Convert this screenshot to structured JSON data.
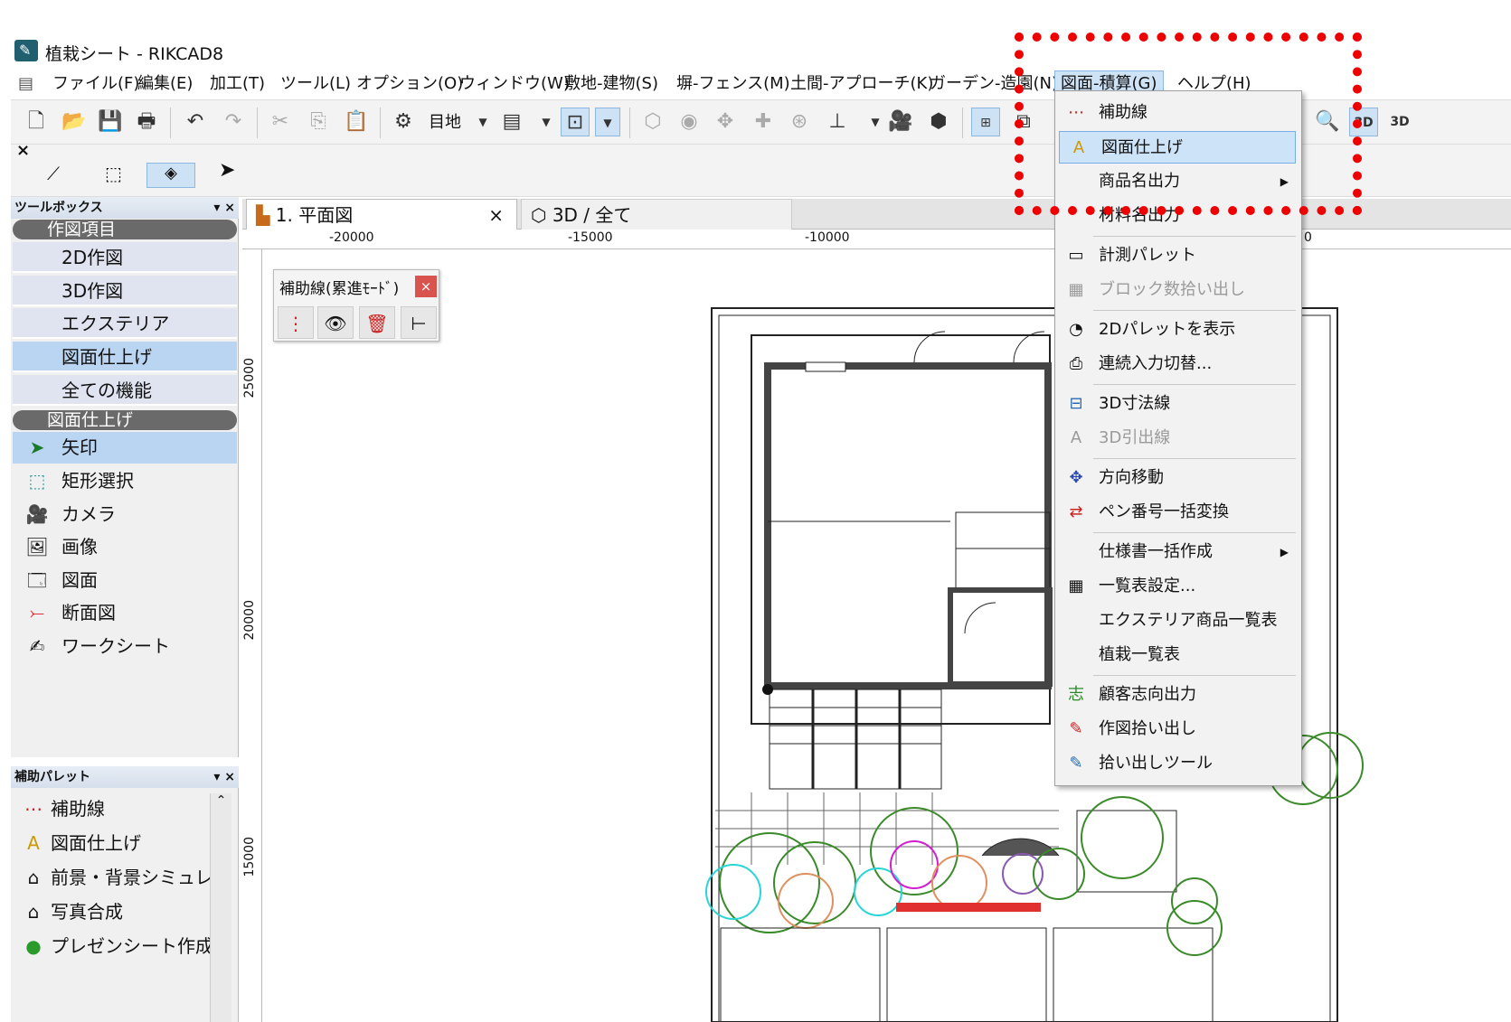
{
  "window": {
    "title": "植栽シート - RIKCAD8"
  },
  "menu": {
    "items": [
      "ファイル(F)",
      "編集(E)",
      "加工(T)",
      "ツール(L)",
      "オプション(O)",
      "ウィンドウ(W)",
      "敷地-建物(S)",
      "塀-フェンス(M)",
      "土間-アプローチ(K)",
      "ガーデン-造園(N)",
      "図面-積算(G)",
      "ヘルプ(H)"
    ],
    "active": "図面-積算(G)"
  },
  "toolbar": {
    "layer_label": "目地"
  },
  "toolbox": {
    "title": "ツールボックス",
    "group1": "作図項目",
    "group1_items": [
      "2D作図",
      "3D作図",
      "エクステリア",
      "図面仕上げ",
      "全ての機能"
    ],
    "group2": "図面仕上げ",
    "group2_items": [
      "矢印",
      "矩形選択",
      "カメラ",
      "画像",
      "図面",
      "断面図",
      "ワークシート"
    ]
  },
  "aux_palette": {
    "title": "補助パレット",
    "items": [
      "補助線",
      "図面仕上げ",
      "前景・背景シミュレー",
      "写真合成",
      "プレゼンシート作成"
    ]
  },
  "tabs": [
    {
      "label": "1. 平面図",
      "close": "×"
    },
    {
      "label": "3D / 全て"
    }
  ],
  "ruler": {
    "h_labels": [
      "-20000",
      "-15000",
      "-10000",
      "0"
    ],
    "v_labels": [
      "25000",
      "20000",
      "15000"
    ]
  },
  "floating_palette": {
    "title": "補助線(累進ﾓｰﾄﾞ)",
    "close": "×"
  },
  "dropdown": {
    "items": [
      {
        "label": "補助線",
        "icon": "auxline-icon"
      },
      {
        "label": "図面仕上げ",
        "icon": "drawing-finish-icon",
        "highlighted": true
      },
      {
        "label": "商品名出力",
        "submenu": true
      },
      {
        "label": "材料名出力"
      },
      {
        "label": "計測パレット",
        "icon": "measure-icon"
      },
      {
        "label": "ブロック数拾い出し",
        "disabled": true
      },
      {
        "label": "2Dパレットを表示",
        "icon": "palette-icon"
      },
      {
        "label": "連続入力切替...",
        "icon": "continuous-icon"
      },
      {
        "label": "3D寸法線",
        "icon": "dimension-icon"
      },
      {
        "label": "3D引出線",
        "disabled": true
      },
      {
        "label": "方向移動",
        "icon": "move-icon"
      },
      {
        "label": "ペン番号一括変換",
        "icon": "pen-icon"
      },
      {
        "label": "仕様書一括作成",
        "submenu": true
      },
      {
        "label": "一覧表設定...",
        "icon": "table-icon"
      },
      {
        "label": "エクステリア商品一覧表"
      },
      {
        "label": "植栽一覧表"
      },
      {
        "label": "顧客志向出力",
        "icon": "customer-icon"
      },
      {
        "label": "作図拾い出し",
        "icon": "pickup-icon"
      },
      {
        "label": "拾い出しツール",
        "icon": "pickup-tool-icon"
      }
    ]
  },
  "colors": {
    "annotation": "#ee0000",
    "highlight": "#cde3f8"
  }
}
